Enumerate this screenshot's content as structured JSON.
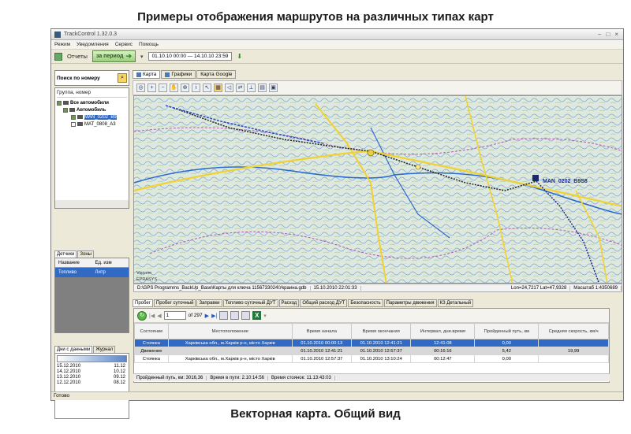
{
  "captions": {
    "top": "Примеры отображения маршрутов на различных типах карт",
    "bottom": "Векторная карта. Общий вид"
  },
  "window": {
    "title": "TrackControl 1.32.0.3",
    "controls": [
      "−",
      "□",
      "×"
    ]
  },
  "menu": [
    "Режим",
    "Уведомления",
    "Сервис",
    "Помощь"
  ],
  "toolbar": {
    "reports_label": "Отчеты",
    "period_label": "за период",
    "date_range": "01.10.10  00:00  — 14.10.10  23:59"
  },
  "search": {
    "label": "Поиск по номеру"
  },
  "tree": {
    "header": "Группа, номер",
    "nodes": [
      {
        "label": "Все автомобили",
        "level": 0
      },
      {
        "label": "Автомобиль",
        "level": 1
      },
      {
        "label": "MAN_0202_B9",
        "level": 2
      },
      {
        "label": "MAT_0808_A3",
        "level": 2
      }
    ]
  },
  "sensors": {
    "tabs": [
      "Детчики",
      "Зоны"
    ],
    "columns": [
      "Название",
      "Ед. изм"
    ],
    "rows": [
      {
        "name": "Топливо",
        "unit": "Литр"
      }
    ]
  },
  "days": {
    "tabs": [
      "Дни с данными",
      "Журнал"
    ],
    "rows": [
      {
        "date": "15.12.2010",
        "val": "11.12"
      },
      {
        "date": "14.12.2010",
        "val": "10.12"
      },
      {
        "date": "13.12.2010",
        "val": "09.12"
      },
      {
        "date": "12.12.2010",
        "val": "08.12"
      }
    ]
  },
  "map_tabs": [
    "Карта",
    "Графики",
    "Карта Google"
  ],
  "map": {
    "vehicle_label": "MAN_0202_B9S8",
    "copyright_1": "Visicom",
    "copyright_2": "EPRASYS"
  },
  "map_status": {
    "path": "D:\\GPS Programms_BackUp_Base\\Карты для ключа 1156733024\\Украина.gdb",
    "datetime": "15.10.2010 22:01:33",
    "coords": "Lon=24,7217 Lat=47,9328",
    "scale": "Масштаб 1:4350689"
  },
  "bottom_tabs": [
    "Пробег",
    "Пробег суточный",
    "Заправки",
    "Топливо суточный ДУТ",
    "Расход",
    "Общий расход ДУТ",
    "Безопасность",
    "Параметры движения",
    "КЗ Детальный"
  ],
  "grid": {
    "page": "1",
    "of_pages": "of 297",
    "columns": [
      "Состояние",
      "Местоположение",
      "Время начала",
      "Время окончания",
      "Интервал, дни.время",
      "Пройденный путь, км",
      "Средняя скорость, км/ч"
    ],
    "rows": [
      {
        "state": "Стоянка",
        "place": "Харківська обл., м.Харків р-н, місто Харків",
        "start": "01.10.2010 00:00:13",
        "end": "01.10.2010 12:41:21",
        "interval": "12:41:08",
        "dist": "0,00",
        "speed": ""
      },
      {
        "state": "Движение",
        "place": "",
        "start": "01.10.2010 12:41:21",
        "end": "01.10.2010 12:57:37",
        "interval": "00:16:16",
        "dist": "5,42",
        "speed": "19,99"
      },
      {
        "state": "Стоянка",
        "place": "Харківська обл., м.Харків р-н, місто Харків",
        "start": "01.10.2010 12:57:37",
        "end": "01.10.2010 13:10:24",
        "interval": "00:12:47",
        "dist": "0,00",
        "speed": ""
      }
    ]
  },
  "summary": {
    "dist": "Пройденный путь, км:  3016,36",
    "move": "Время в пути:  2.10:14:56",
    "stop": "Время стоянок:  11.13:43:03"
  },
  "status": "Готово"
}
